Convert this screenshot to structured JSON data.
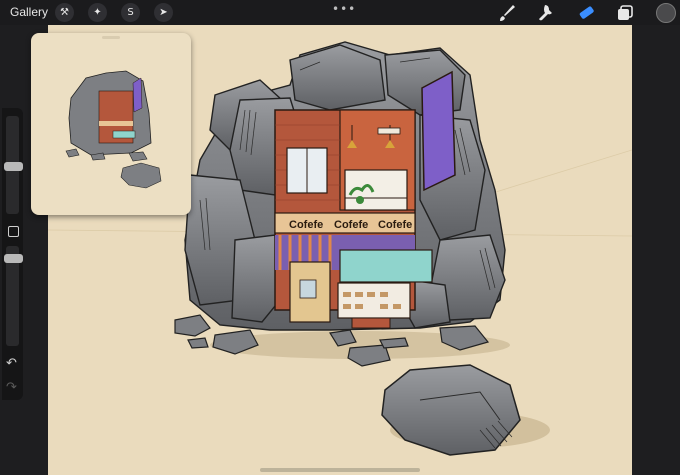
{
  "topbar": {
    "gallery_label": "Gallery",
    "action_icons": [
      "wrench-icon",
      "magic-wand-icon",
      "selection-s-icon",
      "transform-arrow-icon"
    ],
    "more_dots": "•••",
    "tools": [
      "brush-icon",
      "smudge-icon",
      "eraser-icon",
      "layers-icon"
    ],
    "active_tool": "eraser-icon",
    "active_color": "#4a4a4c",
    "accent": "#3a8eff"
  },
  "sidebar": {
    "brush_size_level": 0.25,
    "opacity_level": 0.5,
    "modify_button": "square-icon",
    "undo_icon": "undo-icon",
    "redo_icon": "redo-icon"
  },
  "artwork": {
    "sign_texts": [
      "Cofefe",
      "Cofefe",
      "Cofefe"
    ],
    "background_color": "#eadbbd",
    "rock_color": "#7d7f83",
    "brick_color": "#b4573c",
    "awning_color": "#7a5fb0",
    "sign_color": "#7e5fc8",
    "teal_color": "#8fd4cc"
  },
  "reference_window": {
    "visible": true
  }
}
